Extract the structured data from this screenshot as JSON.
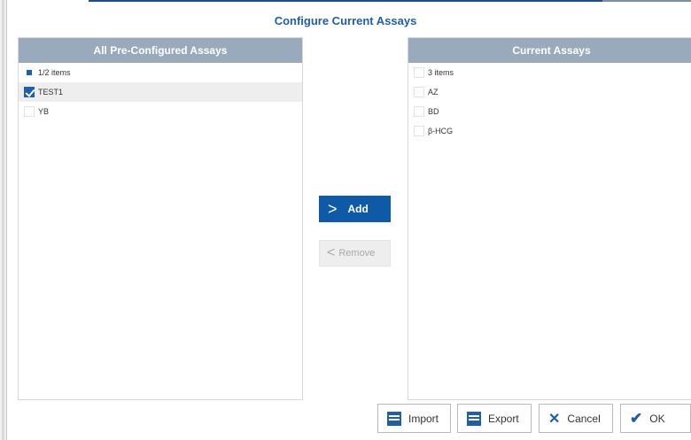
{
  "dialog": {
    "title": "Configure Current Assays"
  },
  "left_panel": {
    "header": "All Pre-Configured Assays",
    "count_label": "1/2 items",
    "items": [
      {
        "label": "TEST1",
        "checked": true
      },
      {
        "label": "YB",
        "checked": false
      }
    ]
  },
  "right_panel": {
    "header": "Current Assays",
    "count_label": "3 items",
    "items": [
      {
        "label": "AZ",
        "checked": false
      },
      {
        "label": "BD",
        "checked": false
      },
      {
        "label": "β-HCG",
        "checked": false
      }
    ]
  },
  "actions": {
    "add_label": "Add",
    "add_icon": ">",
    "remove_label": "Remove",
    "remove_icon": "<"
  },
  "footer": {
    "import_label": "Import",
    "export_label": "Export",
    "cancel_label": "Cancel",
    "ok_label": "OK"
  },
  "colors": {
    "accent": "#1f5fa8",
    "header_bg": "#9aaabd",
    "add_bg": "#0f5aa6"
  }
}
